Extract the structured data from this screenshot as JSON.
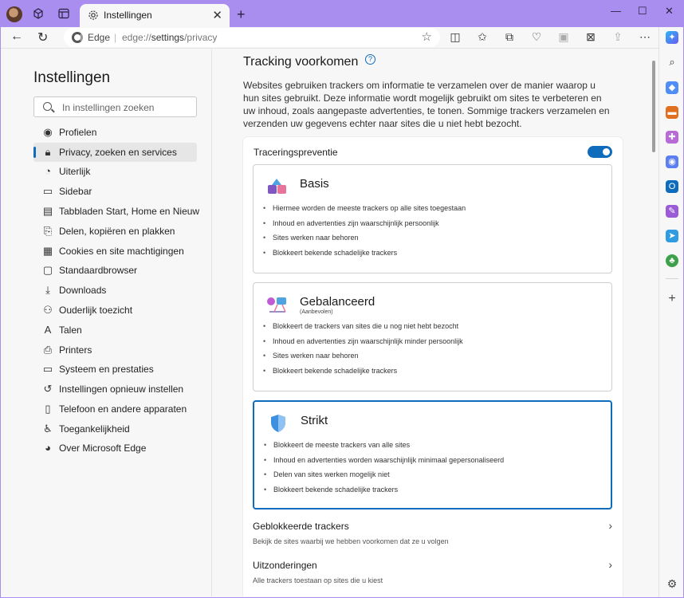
{
  "browser": {
    "tab_title": "Instellingen",
    "address_site": "Edge",
    "address_url_prefix": "edge://",
    "address_url_path": "settings",
    "address_url_suffix": "/privacy"
  },
  "sidebar": {
    "title": "Instellingen",
    "search_placeholder": "In instellingen zoeken",
    "items": [
      {
        "label": "Profielen",
        "icon": "profile-icon"
      },
      {
        "label": "Privacy, zoeken en services",
        "icon": "lock-icon",
        "active": true
      },
      {
        "label": "Uiterlijk",
        "icon": "appearance-icon"
      },
      {
        "label": "Sidebar",
        "icon": "sidebar-icon"
      },
      {
        "label": "Tabbladen Start, Home en Nieuw",
        "icon": "tabs-icon"
      },
      {
        "label": "Delen, kopiëren en plakken",
        "icon": "share-icon"
      },
      {
        "label": "Cookies en site machtigingen",
        "icon": "cookies-icon"
      },
      {
        "label": "Standaardbrowser",
        "icon": "browser-icon"
      },
      {
        "label": "Downloads",
        "icon": "download-icon"
      },
      {
        "label": "Ouderlijk toezicht",
        "icon": "family-icon"
      },
      {
        "label": "Talen",
        "icon": "languages-icon"
      },
      {
        "label": "Printers",
        "icon": "printer-icon"
      },
      {
        "label": "Systeem en prestaties",
        "icon": "system-icon"
      },
      {
        "label": "Instellingen opnieuw instellen",
        "icon": "reset-icon"
      },
      {
        "label": "Telefoon en andere apparaten",
        "icon": "phone-icon"
      },
      {
        "label": "Toegankelijkheid",
        "icon": "accessibility-icon"
      },
      {
        "label": "Over Microsoft Edge",
        "icon": "edge-icon"
      }
    ]
  },
  "main": {
    "title": "Tracking voorkomen",
    "description": "Websites gebruiken trackers om informatie te verzamelen over de manier waarop u hun sites gebruikt. Deze informatie wordt mogelijk gebruikt om sites te verbeteren en uw inhoud, zoals aangepaste advertenties, te tonen. Sommige trackers verzamelen en verzenden uw gegevens echter naar sites die u niet hebt bezocht.",
    "prevention_label": "Traceringspreventie",
    "prevention_enabled": true,
    "options": [
      {
        "title": "Basis",
        "subtitle": "",
        "selected": false,
        "bullets": [
          "Hiermee worden de meeste trackers op alle sites toegestaan",
          "Inhoud en advertenties zijn waarschijnlijk persoonlijk",
          "Sites werken naar behoren",
          "Blokkeert bekende schadelijke trackers"
        ]
      },
      {
        "title": "Gebalanceerd",
        "subtitle": "(Aanbevolen)",
        "selected": false,
        "bullets": [
          "Blokkeert de trackers van sites die u nog niet hebt bezocht",
          "Inhoud en advertenties zijn waarschijnlijk minder persoonlijk",
          "Sites werken naar behoren",
          "Blokkeert bekende schadelijke trackers"
        ]
      },
      {
        "title": "Strikt",
        "subtitle": "",
        "selected": true,
        "bullets": [
          "Blokkeert de meeste trackers van alle sites",
          "Inhoud en advertenties worden waarschijnlijk minimaal gepersonaliseerd",
          "Delen van sites werken mogelijk niet",
          "Blokkeert bekende schadelijke trackers"
        ]
      }
    ],
    "blocked_trackers": {
      "title": "Geblokkeerde trackers",
      "subtitle": "Bekijk de sites waarbij we hebben voorkomen dat ze u volgen"
    },
    "exceptions": {
      "title": "Uitzonderingen",
      "subtitle": "Alle trackers toestaan op sites die u kiest"
    }
  },
  "colors": {
    "titlebar": "#a98ef0",
    "accent": "#0f6cbd"
  }
}
